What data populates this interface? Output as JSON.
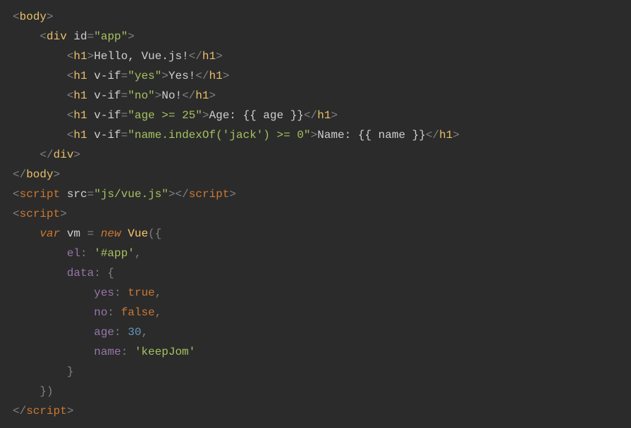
{
  "code": {
    "lines": [
      [
        {
          "cls": "c-punct",
          "t": "<"
        },
        {
          "cls": "c-tag",
          "t": "body"
        },
        {
          "cls": "c-punct",
          "t": ">"
        }
      ],
      [
        {
          "cls": null,
          "t": "    "
        },
        {
          "cls": "c-punct",
          "t": "<"
        },
        {
          "cls": "c-tag",
          "t": "div "
        },
        {
          "cls": "c-attr",
          "t": "id"
        },
        {
          "cls": "c-punct",
          "t": "="
        },
        {
          "cls": "c-str",
          "t": "\"app\""
        },
        {
          "cls": "c-punct",
          "t": ">"
        }
      ],
      [
        {
          "cls": null,
          "t": "        "
        },
        {
          "cls": "c-punct",
          "t": "<"
        },
        {
          "cls": "c-tag",
          "t": "h1"
        },
        {
          "cls": "c-punct",
          "t": ">"
        },
        {
          "cls": "c-text",
          "t": "Hello, Vue.js!"
        },
        {
          "cls": "c-punct",
          "t": "</"
        },
        {
          "cls": "c-tag",
          "t": "h1"
        },
        {
          "cls": "c-punct",
          "t": ">"
        }
      ],
      [
        {
          "cls": null,
          "t": "        "
        },
        {
          "cls": "c-punct",
          "t": "<"
        },
        {
          "cls": "c-tag",
          "t": "h1 "
        },
        {
          "cls": "c-attr",
          "t": "v-if"
        },
        {
          "cls": "c-punct",
          "t": "="
        },
        {
          "cls": "c-str",
          "t": "\"yes\""
        },
        {
          "cls": "c-punct",
          "t": ">"
        },
        {
          "cls": "c-text",
          "t": "Yes!"
        },
        {
          "cls": "c-punct",
          "t": "</"
        },
        {
          "cls": "c-tag",
          "t": "h1"
        },
        {
          "cls": "c-punct",
          "t": ">"
        }
      ],
      [
        {
          "cls": null,
          "t": "        "
        },
        {
          "cls": "c-punct",
          "t": "<"
        },
        {
          "cls": "c-tag",
          "t": "h1 "
        },
        {
          "cls": "c-attr",
          "t": "v-if"
        },
        {
          "cls": "c-punct",
          "t": "="
        },
        {
          "cls": "c-str",
          "t": "\"no\""
        },
        {
          "cls": "c-punct",
          "t": ">"
        },
        {
          "cls": "c-text",
          "t": "No!"
        },
        {
          "cls": "c-punct",
          "t": "</"
        },
        {
          "cls": "c-tag",
          "t": "h1"
        },
        {
          "cls": "c-punct",
          "t": ">"
        }
      ],
      [
        {
          "cls": null,
          "t": "        "
        },
        {
          "cls": "c-punct",
          "t": "<"
        },
        {
          "cls": "c-tag",
          "t": "h1 "
        },
        {
          "cls": "c-attr",
          "t": "v-if"
        },
        {
          "cls": "c-punct",
          "t": "="
        },
        {
          "cls": "c-str",
          "t": "\"age >= 25\""
        },
        {
          "cls": "c-punct",
          "t": ">"
        },
        {
          "cls": "c-text",
          "t": "Age: {{ age }}"
        },
        {
          "cls": "c-punct",
          "t": "</"
        },
        {
          "cls": "c-tag",
          "t": "h1"
        },
        {
          "cls": "c-punct",
          "t": ">"
        }
      ],
      [
        {
          "cls": null,
          "t": "        "
        },
        {
          "cls": "c-punct",
          "t": "<"
        },
        {
          "cls": "c-tag",
          "t": "h1 "
        },
        {
          "cls": "c-attr",
          "t": "v-if"
        },
        {
          "cls": "c-punct",
          "t": "="
        },
        {
          "cls": "c-str",
          "t": "\"name.indexOf('jack') >= 0\""
        },
        {
          "cls": "c-punct",
          "t": ">"
        },
        {
          "cls": "c-text",
          "t": "Name: {{ name }}"
        },
        {
          "cls": "c-punct",
          "t": "</"
        },
        {
          "cls": "c-tag",
          "t": "h1"
        },
        {
          "cls": "c-punct",
          "t": ">"
        }
      ],
      [
        {
          "cls": null,
          "t": "    "
        },
        {
          "cls": "c-punct",
          "t": "</"
        },
        {
          "cls": "c-tag",
          "t": "div"
        },
        {
          "cls": "c-punct",
          "t": ">"
        }
      ],
      [
        {
          "cls": "c-punct",
          "t": "</"
        },
        {
          "cls": "c-tag",
          "t": "body"
        },
        {
          "cls": "c-punct",
          "t": ">"
        }
      ],
      [
        {
          "cls": "c-punct",
          "t": "<"
        },
        {
          "cls": "c-script",
          "t": "script "
        },
        {
          "cls": "c-attr",
          "t": "src"
        },
        {
          "cls": "c-punct",
          "t": "="
        },
        {
          "cls": "c-str",
          "t": "\"js/vue.js\""
        },
        {
          "cls": "c-punct",
          "t": "></"
        },
        {
          "cls": "c-script",
          "t": "script"
        },
        {
          "cls": "c-punct",
          "t": ">"
        }
      ],
      [
        {
          "cls": "c-punct",
          "t": "<"
        },
        {
          "cls": "c-script",
          "t": "script"
        },
        {
          "cls": "c-punct",
          "t": ">"
        }
      ],
      [
        {
          "cls": null,
          "t": "    "
        },
        {
          "cls": "c-key",
          "t": "var "
        },
        {
          "cls": "c-ident",
          "t": "vm "
        },
        {
          "cls": "c-punct",
          "t": "= "
        },
        {
          "cls": "c-key",
          "t": "new "
        },
        {
          "cls": "c-func",
          "t": "Vue"
        },
        {
          "cls": "c-punct",
          "t": "({"
        }
      ],
      [
        {
          "cls": null,
          "t": "        "
        },
        {
          "cls": "c-prop",
          "t": "el"
        },
        {
          "cls": "c-punct",
          "t": ": "
        },
        {
          "cls": "c-str",
          "t": "'#app'"
        },
        {
          "cls": "c-punct",
          "t": ","
        }
      ],
      [
        {
          "cls": null,
          "t": "        "
        },
        {
          "cls": "c-prop",
          "t": "data"
        },
        {
          "cls": "c-punct",
          "t": ": {"
        }
      ],
      [
        {
          "cls": null,
          "t": "            "
        },
        {
          "cls": "c-prop",
          "t": "yes"
        },
        {
          "cls": "c-punct",
          "t": ": "
        },
        {
          "cls": "c-bool",
          "t": "true"
        },
        {
          "cls": "c-punct",
          "t": ","
        }
      ],
      [
        {
          "cls": null,
          "t": "            "
        },
        {
          "cls": "c-prop",
          "t": "no"
        },
        {
          "cls": "c-punct",
          "t": ": "
        },
        {
          "cls": "c-bool",
          "t": "false"
        },
        {
          "cls": "c-punct",
          "t": ","
        }
      ],
      [
        {
          "cls": null,
          "t": "            "
        },
        {
          "cls": "c-prop",
          "t": "age"
        },
        {
          "cls": "c-punct",
          "t": ": "
        },
        {
          "cls": "c-num",
          "t": "30"
        },
        {
          "cls": "c-punct",
          "t": ","
        }
      ],
      [
        {
          "cls": null,
          "t": "            "
        },
        {
          "cls": "c-prop",
          "t": "name"
        },
        {
          "cls": "c-punct",
          "t": ": "
        },
        {
          "cls": "c-str",
          "t": "'keepJom'"
        }
      ],
      [
        {
          "cls": null,
          "t": "        "
        },
        {
          "cls": "c-punct",
          "t": "}"
        }
      ],
      [
        {
          "cls": null,
          "t": "    "
        },
        {
          "cls": "c-punct",
          "t": "})"
        }
      ],
      [
        {
          "cls": "c-punct",
          "t": "</"
        },
        {
          "cls": "c-script",
          "t": "script"
        },
        {
          "cls": "c-punct",
          "t": ">"
        }
      ]
    ]
  }
}
